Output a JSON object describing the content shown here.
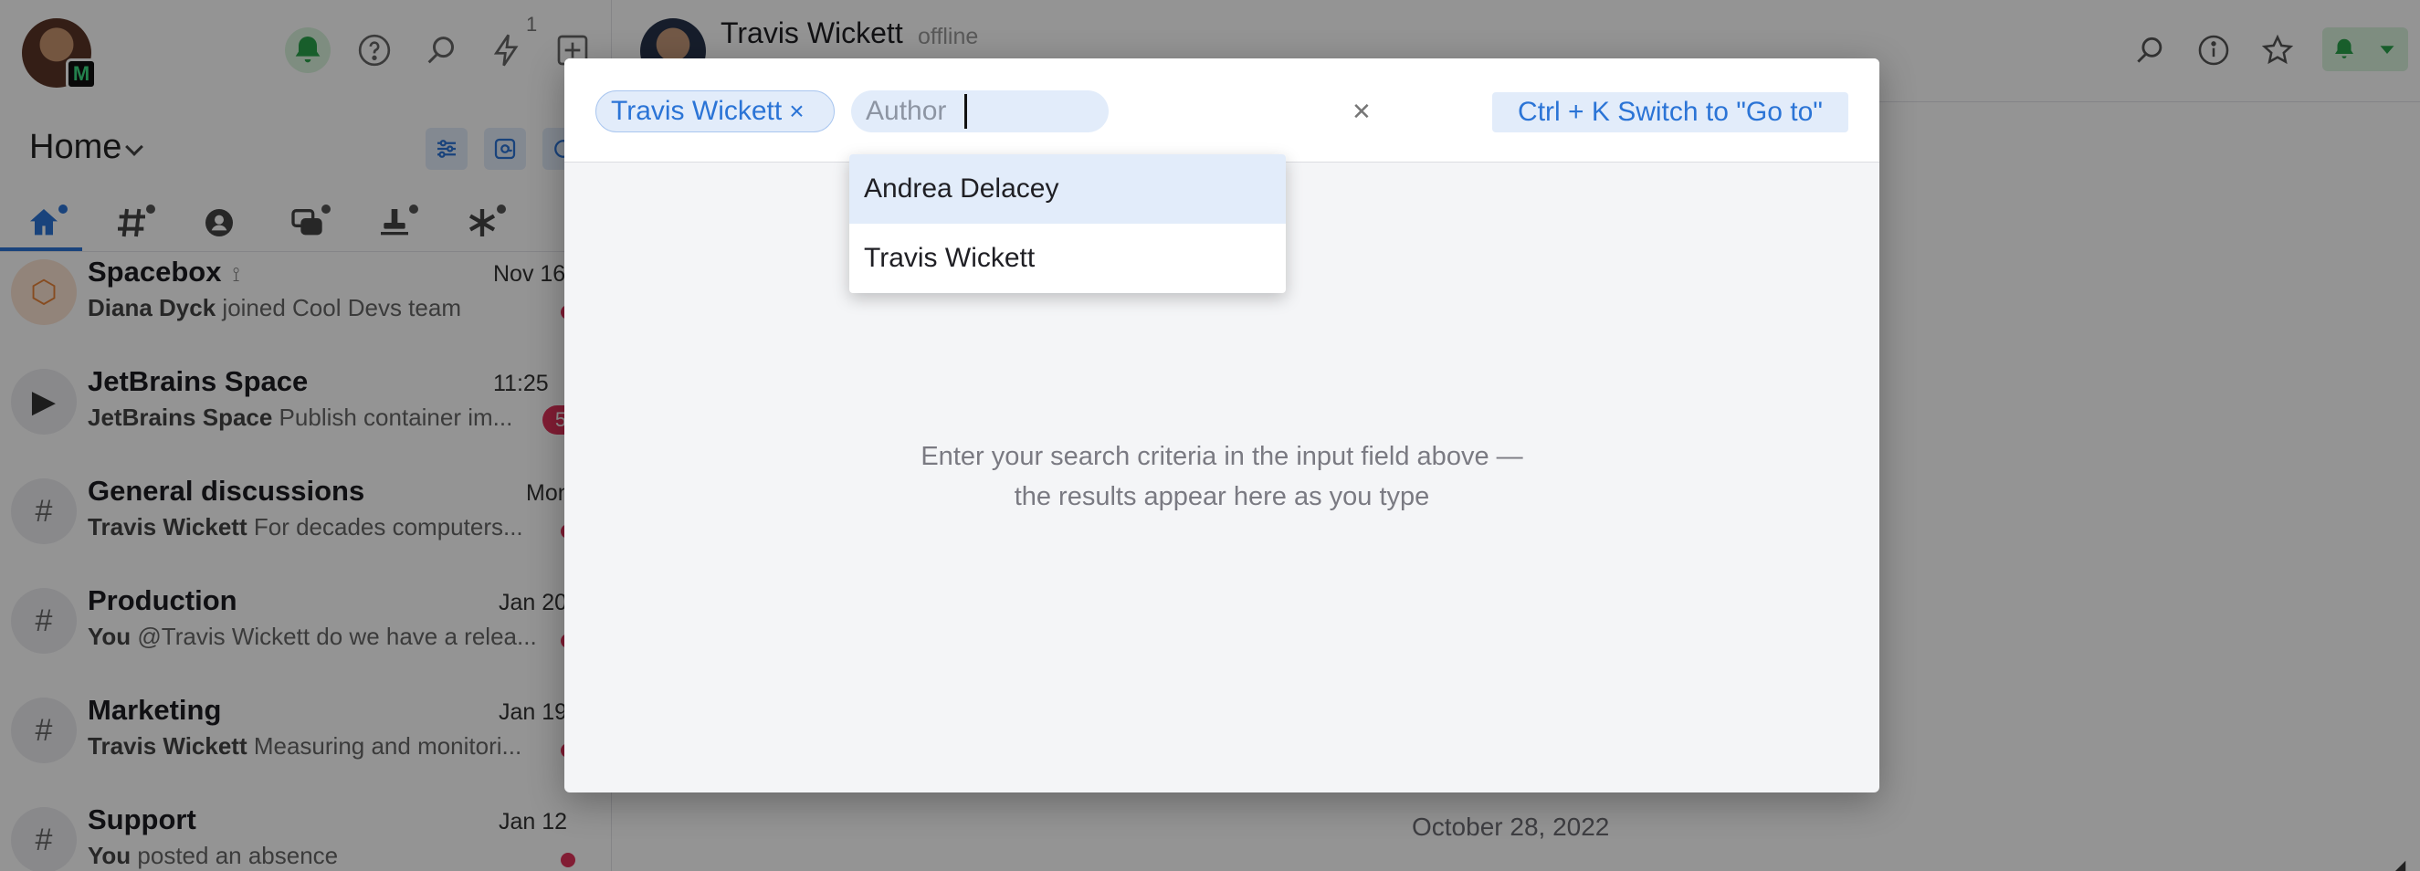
{
  "sidebar": {
    "bolt_count": "1",
    "home_title": "Home",
    "chats": [
      {
        "name": "Spacebox",
        "time": "Nov 16",
        "author": "Diana Dyck",
        "text": " joined Cool Devs team",
        "avatar": "package-icon",
        "rss": true,
        "dot": true
      },
      {
        "name": "JetBrains Space",
        "time": "11:25",
        "author": "JetBrains Space",
        "text": " Publish container im...",
        "avatar": "play-icon",
        "unread": "5"
      },
      {
        "name": "General discussions",
        "time": "Mon",
        "author": "Travis Wickett",
        "text": " For decades computers...",
        "avatar": "hash-icon",
        "dot": true
      },
      {
        "name": "Production",
        "time": "Jan 20",
        "author": "You",
        "text": " @Travis Wickett do we have a relea...",
        "avatar": "hash-icon",
        "dot": true
      },
      {
        "name": "Marketing",
        "time": "Jan 19",
        "author": "Travis Wickett",
        "text": " Measuring and monitori...",
        "avatar": "hash-icon",
        "dot": true
      },
      {
        "name": "Support",
        "time": "Jan 12",
        "author": "You",
        "text": " posted an absence",
        "avatar": "hash-icon",
        "dot": true
      }
    ]
  },
  "main": {
    "peer_name": "Travis Wickett",
    "peer_status": "offline",
    "date_label": "October 28, 2022"
  },
  "search_modal": {
    "selected_author_chip": "Travis Wickett",
    "author_input_placeholder": "Author",
    "author_input_value": "",
    "switch_hint": "Ctrl + K Switch to \"Go to\"",
    "dropdown_options": [
      "Andrea Delacey",
      "Travis Wickett"
    ],
    "highlighted_option": "Andrea Delacey",
    "empty_line_1": "Enter your search criteria in the input field above —",
    "empty_line_2": "the results appear here as you type"
  },
  "colors": {
    "accent": "#2b74d6",
    "accent_bg": "#e2ecfa",
    "notification_green": "#2aa24a",
    "unread_red": "#e0335a"
  },
  "icons": [
    "bell-icon",
    "help-icon",
    "search-icon",
    "bolt-icon",
    "plus-icon",
    "filter-icon",
    "mention-icon",
    "home-icon",
    "channels-icon",
    "person-icon",
    "chats-icon",
    "stamp-icon",
    "asterisk-icon",
    "info-icon",
    "star-icon",
    "chevron-down-icon",
    "close-icon"
  ]
}
